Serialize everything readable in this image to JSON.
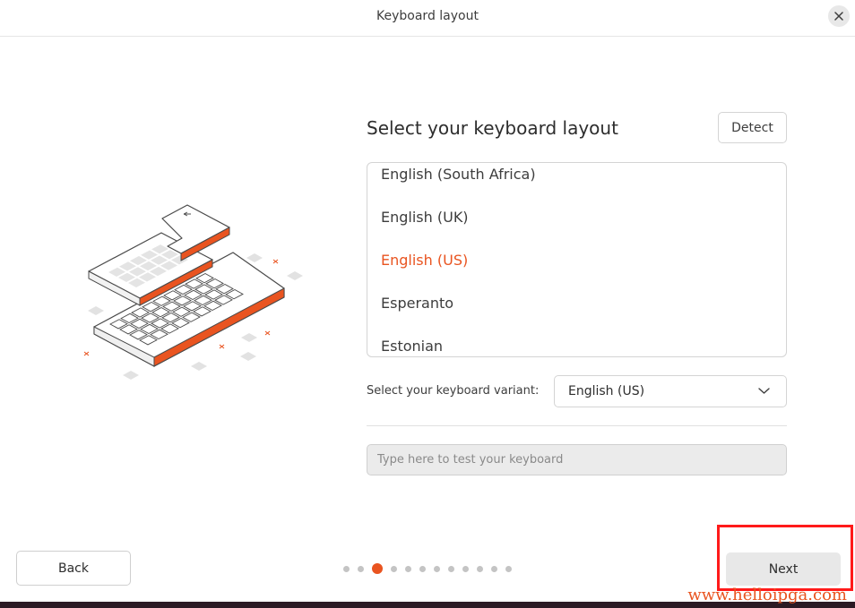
{
  "window": {
    "title": "Keyboard layout"
  },
  "heading": "Select your keyboard layout",
  "buttons": {
    "detect": "Detect",
    "back": "Back",
    "next": "Next"
  },
  "layouts": [
    {
      "label": "English (South Africa)",
      "selected": false
    },
    {
      "label": "English (UK)",
      "selected": false
    },
    {
      "label": "English (US)",
      "selected": true
    },
    {
      "label": "Esperanto",
      "selected": false
    },
    {
      "label": "Estonian",
      "selected": false
    }
  ],
  "variant": {
    "label": "Select your keyboard variant:",
    "value": "English (US)"
  },
  "test_input": {
    "placeholder": "Type here to test your keyboard",
    "value": ""
  },
  "progress": {
    "total_steps": 12,
    "current_step": 3
  },
  "watermark": "www.helloipga.com",
  "colors": {
    "accent": "#e95420",
    "highlight": "#ff1a1a",
    "neutral_button": "#e8e8e8"
  },
  "icons": {
    "close": "close-icon",
    "dropdown": "chevron-down-icon",
    "illustration": "keyboard-illustration"
  }
}
